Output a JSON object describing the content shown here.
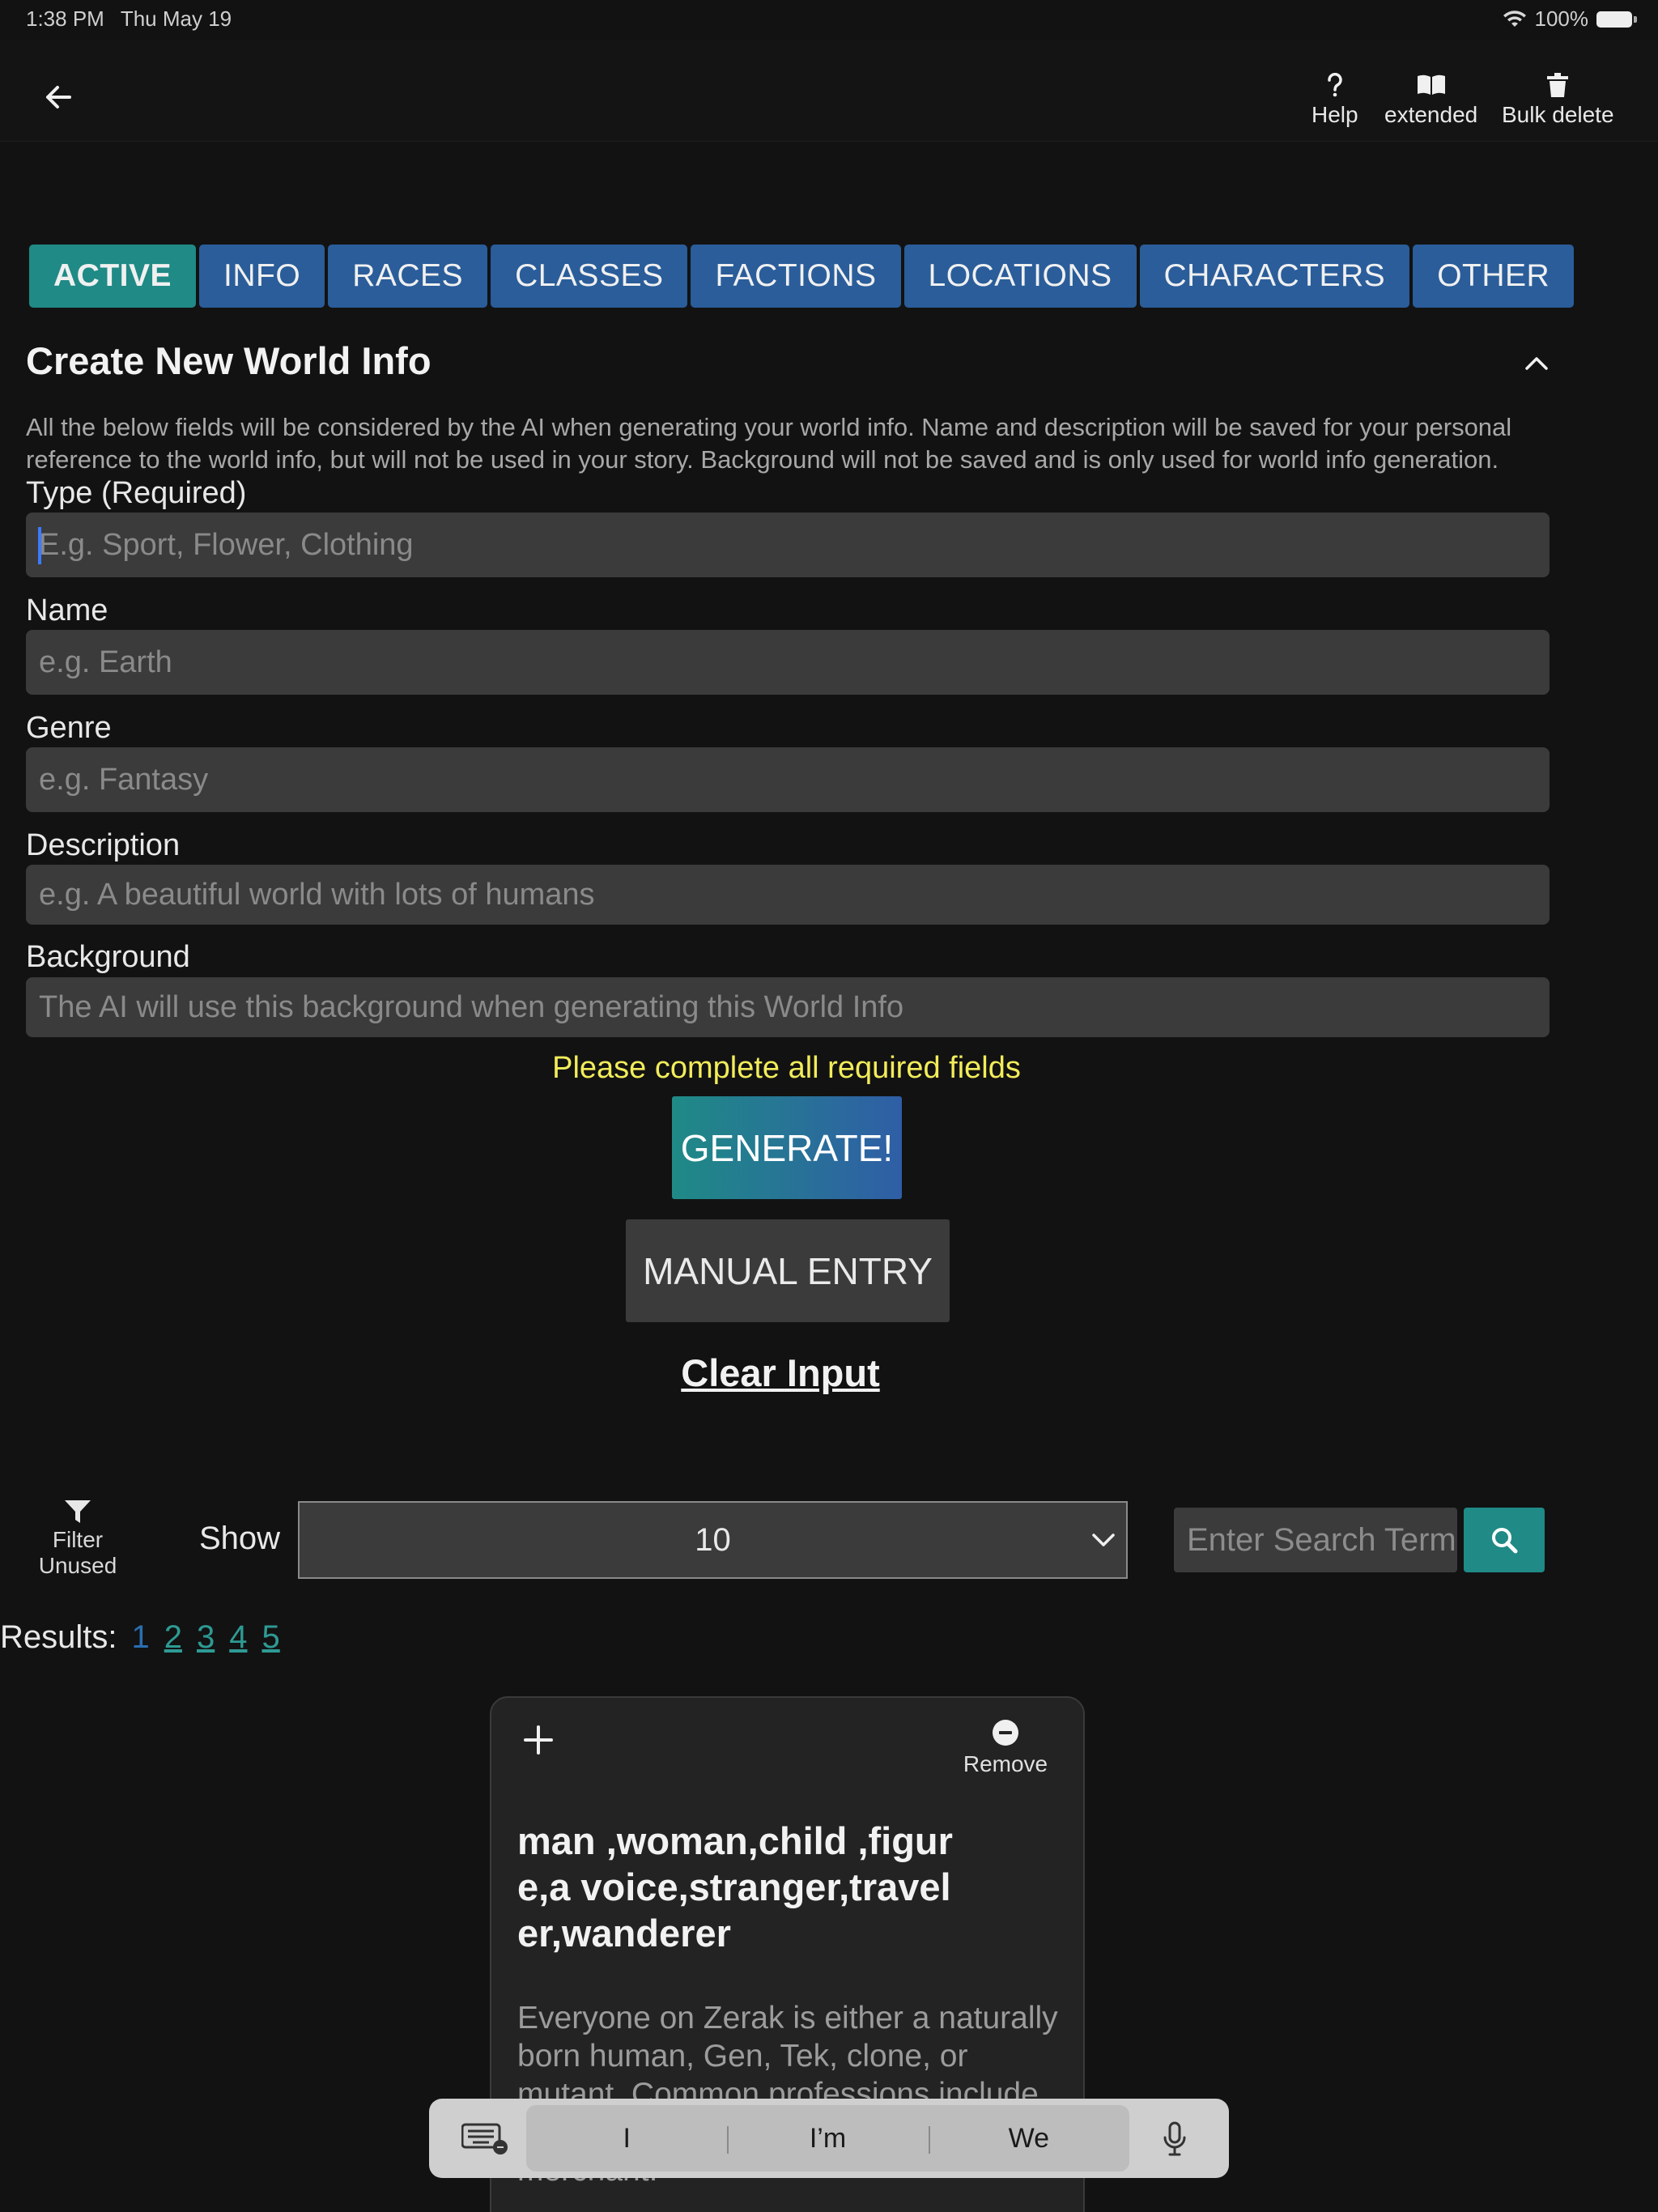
{
  "status": {
    "time": "1:38 PM",
    "date": "Thu May 19",
    "battery": "100%"
  },
  "toolbar": {
    "help": "Help",
    "extended": "extended",
    "bulk_delete": "Bulk delete"
  },
  "tabs": [
    {
      "label": "ACTIVE",
      "active": true
    },
    {
      "label": "INFO"
    },
    {
      "label": "RACES"
    },
    {
      "label": "CLASSES"
    },
    {
      "label": "FACTIONS"
    },
    {
      "label": "LOCATIONS"
    },
    {
      "label": "CHARACTERS"
    },
    {
      "label": "OTHER"
    }
  ],
  "form": {
    "title": "Create New World Info",
    "intro": "All the below fields will be considered by the AI when generating your world info. Name and description will be saved for your personal reference to the world info, but will not be used in your story. Background will not be saved and is only used for world info generation.",
    "type": {
      "label": "Type (Required)",
      "placeholder": "E.g. Sport, Flower, Clothing",
      "value": ""
    },
    "name": {
      "label": "Name",
      "placeholder": "e.g. Earth",
      "value": ""
    },
    "genre": {
      "label": "Genre",
      "placeholder": "e.g. Fantasy",
      "value": ""
    },
    "description": {
      "label": "Description",
      "placeholder": "e.g. A beautiful world with lots of humans",
      "value": ""
    },
    "background": {
      "label": "Background",
      "placeholder": "The AI will use this background when generating this World Info",
      "value": ""
    },
    "warning": "Please complete all required fields",
    "generate_label": "GENERATE!",
    "manual_label": "MANUAL ENTRY",
    "clear_label": "Clear Input"
  },
  "list_controls": {
    "filter_label_1": "Filter",
    "filter_label_2": "Unused",
    "show_label": "Show",
    "show_value": "10",
    "search_placeholder": "Enter Search Term",
    "results_label": "Results:",
    "pages": [
      "1",
      "2",
      "3",
      "4",
      "5"
    ],
    "current_page": "1"
  },
  "card": {
    "remove_label": "Remove",
    "title": "man ,woman,child ,figure,a voice,stranger,traveler,wanderer",
    "description": "Everyone on Zerak is either a naturally born human, Gen, Tek, clone, or mutant. Common professions include mercenary, soldier, explorer, and merchant."
  },
  "keyboard": {
    "suggestions": [
      "I",
      "I’m",
      "We"
    ]
  },
  "colors": {
    "background": "#121212",
    "tab": "#2a5d9a",
    "tab_active": "#1f8a86",
    "warning": "#f2ec5a",
    "field": "#3b3b3b"
  }
}
